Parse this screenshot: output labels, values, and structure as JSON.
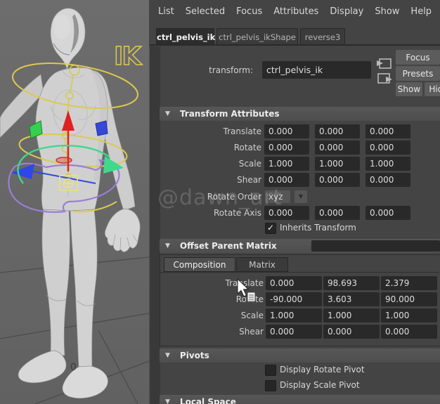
{
  "menu_bar": {
    "items": [
      "List",
      "Selected",
      "Focus",
      "Attributes",
      "Display",
      "Show",
      "Help"
    ]
  },
  "tab_bar": {
    "tabs": [
      {
        "label": "ctrl_pelvis_ik",
        "active": true
      },
      {
        "label": "ctrl_pelvis_ikShape",
        "active": false
      },
      {
        "label": "reverse3",
        "active": false
      }
    ]
  },
  "header": {
    "transform_label": "transform:",
    "transform_value": "ctrl_pelvis_ik",
    "focus_button": "Focus",
    "presets_button": "Presets",
    "show_button": "Show",
    "hide_button": "Hide"
  },
  "transform_attributes": {
    "title": "Transform Attributes",
    "translate": {
      "label": "Translate",
      "x": "0.000",
      "y": "0.000",
      "z": "0.000"
    },
    "rotate": {
      "label": "Rotate",
      "x": "0.000",
      "y": "0.000",
      "z": "0.000"
    },
    "scale": {
      "label": "Scale",
      "x": "1.000",
      "y": "1.000",
      "z": "1.000"
    },
    "shear": {
      "label": "Shear",
      "x": "0.000",
      "y": "0.000",
      "z": "0.000"
    },
    "rotate_order": {
      "label": "Rotate Order",
      "value": "xyz"
    },
    "rotate_axis": {
      "label": "Rotate Axis",
      "x": "0.000",
      "y": "0.000",
      "z": "0.000"
    },
    "inherits_transform": {
      "label": "Inherits Transform",
      "checked": true,
      "check_glyph": "✓"
    }
  },
  "offset_parent_matrix": {
    "title": "Offset Parent Matrix",
    "tabs": {
      "composition": "Composition",
      "matrix": "Matrix"
    },
    "translate": {
      "label": "Translate",
      "x": "0.000",
      "y": "98.693",
      "z": "2.379"
    },
    "rotate": {
      "label": "Rotate",
      "x": "-90.000",
      "y": "3.603",
      "z": "90.000"
    },
    "scale": {
      "label": "Scale",
      "x": "1.000",
      "y": "1.000",
      "z": "1.000"
    },
    "shear": {
      "label": "Shear",
      "x": "0.000",
      "y": "0.000",
      "z": "0.000"
    }
  },
  "pivots": {
    "title": "Pivots",
    "display_rotate_pivot": {
      "label": "Display Rotate Pivot",
      "checked": false
    },
    "display_scale_pivot": {
      "label": "Display Scale Pivot",
      "checked": false
    }
  },
  "local_space": {
    "title": "Local Space"
  },
  "viewport": {
    "ik_label": "IK",
    "origin_label": "0",
    "watermark": "@dawn_art"
  },
  "ui": {
    "collapse_glyph": "▼",
    "dropdown_glyph": "▼"
  },
  "colors": {
    "panel_bg": "#444444",
    "field_bg": "#292929",
    "header_bg": "#525252",
    "button_bg": "#5c5c5c",
    "viewport_bg": "#6a6a6a",
    "control_yellow": "#dcc94f",
    "control_green": "#3fd98c",
    "control_blue": "#2f47e8",
    "control_red": "#e02020",
    "control_purple": "#9b7ed6",
    "square_green": "#35d04e",
    "square_blue": "#3548d8"
  }
}
